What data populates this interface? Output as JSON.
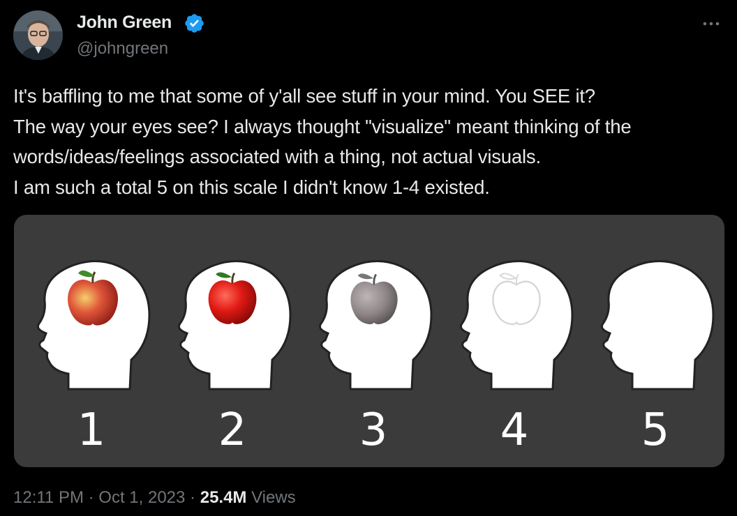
{
  "author": {
    "display_name": "John Green",
    "handle": "@johngreen",
    "verified": true,
    "verified_icon": "verified-badge-icon",
    "badge_color": "#1d9bf0"
  },
  "tweet": {
    "lines": [
      "It's baffling to me that some of y'all see stuff in your mind. You SEE it?",
      "The way your eyes see? I always thought \"visualize\" meant thinking of the",
      "words/ideas/feelings associated with a thing, not actual visuals.",
      "I am such a total 5 on this scale I didn't know 1-4 existed."
    ]
  },
  "media": {
    "scale": [
      {
        "number": "1",
        "apple": "realistic-apple-icon"
      },
      {
        "number": "2",
        "apple": "red-apple-icon"
      },
      {
        "number": "3",
        "apple": "gray-apple-icon"
      },
      {
        "number": "4",
        "apple": "outline-apple-icon"
      },
      {
        "number": "5",
        "apple": "none"
      }
    ]
  },
  "meta": {
    "time": "12:11 PM",
    "separator": "·",
    "date": "Oct 1, 2023",
    "views_count": "25.4M",
    "views_label": "Views"
  },
  "colors": {
    "background": "#000000",
    "text": "#e7e9ea",
    "secondary_text": "#71767b",
    "media_background": "#3b3b3b"
  }
}
